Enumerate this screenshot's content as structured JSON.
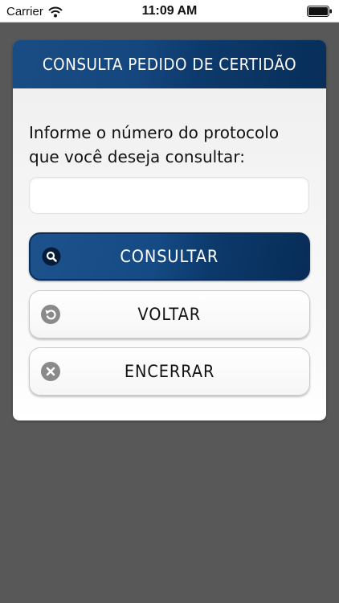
{
  "status_bar": {
    "carrier": "Carrier",
    "time": "11:09 AM"
  },
  "header": {
    "title": "CONSULTA PEDIDO DE CERTIDÃO"
  },
  "form": {
    "prompt": "Informe o número do protocolo que você deseja consultar:",
    "input_value": "",
    "input_placeholder": ""
  },
  "buttons": {
    "consultar": "CONSULTAR",
    "voltar": "VOLTAR",
    "encerrar": "ENCERRAR"
  },
  "icons": {
    "consultar": "search-icon",
    "voltar": "undo-icon",
    "encerrar": "close-circle-icon",
    "wifi": "wifi-icon",
    "battery": "battery-icon"
  },
  "colors": {
    "background": "#585858",
    "header_blue": "#14467f",
    "primary_button": "#154a84",
    "icon_gray": "#8a8a8a"
  }
}
